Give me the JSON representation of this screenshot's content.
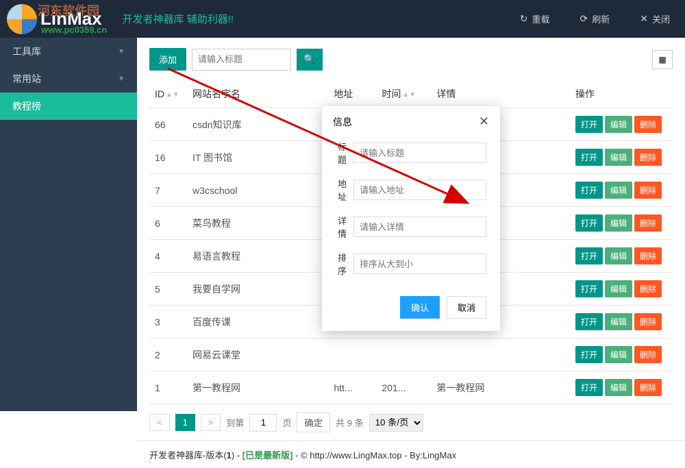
{
  "titlebar": {
    "logo_text": "LinMax",
    "watermark_top": "河东软件园",
    "watermark_url": "www.pc0359.cn",
    "subtitle": "开发者神器库 辅助利器!!",
    "reload": "重载",
    "refresh": "刷新",
    "close": "关闭"
  },
  "sidebar": {
    "items": [
      {
        "label": "工具库",
        "has_caret": true
      },
      {
        "label": "常用站",
        "has_caret": true
      },
      {
        "label": "教程榜",
        "has_caret": false,
        "active": true
      }
    ]
  },
  "toolbar": {
    "add": "添加",
    "search_placeholder": "请输入标题"
  },
  "table": {
    "cols": {
      "id": "ID",
      "name": "网站名字名",
      "addr": "地址",
      "time": "时间",
      "detail": "详情",
      "ops": "操作"
    },
    "row_btn": {
      "open": "打开",
      "edit": "编辑",
      "del": "删除"
    },
    "rows": [
      {
        "id": "66",
        "name": "csdn知识库",
        "addr": "",
        "time": "",
        "detail": ""
      },
      {
        "id": "16",
        "name": "IT 图书馆",
        "addr": "",
        "time": "",
        "detail": ""
      },
      {
        "id": "7",
        "name": "w3cschool",
        "addr": "",
        "time": "",
        "detail": ""
      },
      {
        "id": "6",
        "name": "菜鸟教程",
        "addr": "",
        "time": "",
        "detail": ""
      },
      {
        "id": "4",
        "name": "易语言教程",
        "addr": "",
        "time": "",
        "detail": ""
      },
      {
        "id": "5",
        "name": "我要自学网",
        "addr": "",
        "time": "",
        "detail": ""
      },
      {
        "id": "3",
        "name": "百度传课",
        "addr": "",
        "time": "",
        "detail": ""
      },
      {
        "id": "2",
        "name": "网易云课堂",
        "addr": "",
        "time": "",
        "detail": ""
      },
      {
        "id": "1",
        "name": "第一教程网",
        "addr": "htt...",
        "time": "201...",
        "detail": "第一教程网"
      }
    ]
  },
  "pager": {
    "prev": "<",
    "page": "1",
    "next": ">",
    "goto_prefix": "到第",
    "goto_val": "1",
    "goto_suffix": "页",
    "confirm": "确定",
    "total": "共 9 条",
    "per": "10 条/页"
  },
  "footer": {
    "prefix": "开发者神器库-版本(",
    "version": "1",
    "mid": ") - ",
    "latest": "[已是最新版]",
    "tail": " - © http://www.LingMax.top - By:LingMax"
  },
  "modal": {
    "title": "信息",
    "f_title": "标题",
    "p_title": "请输入标题",
    "f_addr": "地址",
    "p_addr": "请输入地址",
    "f_detail": "详情",
    "p_detail": "请输入详情",
    "f_order": "排序",
    "p_order": "排序从大到小",
    "ok": "确认",
    "cancel": "取消"
  }
}
